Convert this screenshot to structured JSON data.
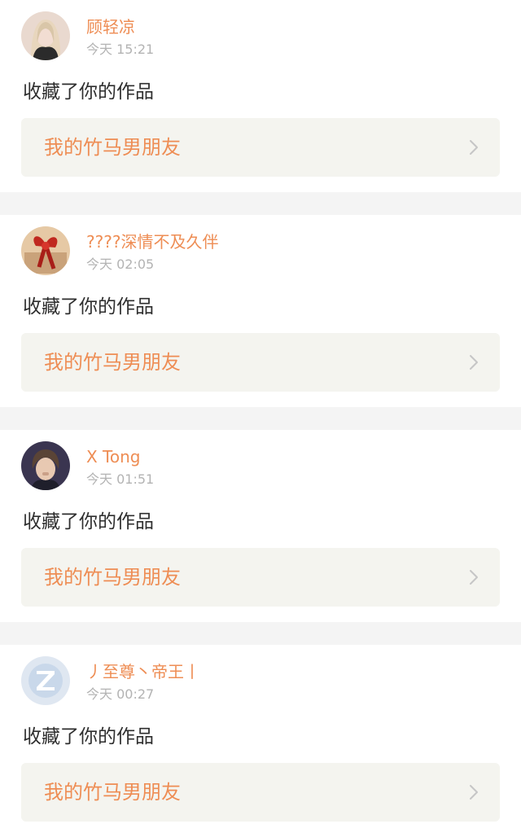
{
  "notifications": [
    {
      "username": "顾轻凉",
      "timestamp": "今天 15:21",
      "action": "收藏了你的作品",
      "work_title": "我的竹马男朋友",
      "avatar_icon": "portrait-photo-blonde"
    },
    {
      "username": "????深情不及久伴",
      "timestamp": "今天 02:05",
      "action": "收藏了你的作品",
      "work_title": "我的竹马男朋友",
      "avatar_icon": "gift-bow-photo"
    },
    {
      "username": "X Tong",
      "timestamp": "今天 01:51",
      "action": "收藏了你的作品",
      "work_title": "我的竹马男朋友",
      "avatar_icon": "portrait-photo-dark"
    },
    {
      "username": "丿至尊丶帝王丨",
      "timestamp": "今天 00:27",
      "action": "收藏了你的作品",
      "work_title": "我的竹马男朋友",
      "avatar_icon": "default-z-avatar"
    }
  ],
  "colors": {
    "accent": "#ee8d54",
    "link_background": "#f4f4ef",
    "timestamp": "#b3b3b3",
    "action_text": "#2e2e2e",
    "separator": "#f4f4f4"
  }
}
